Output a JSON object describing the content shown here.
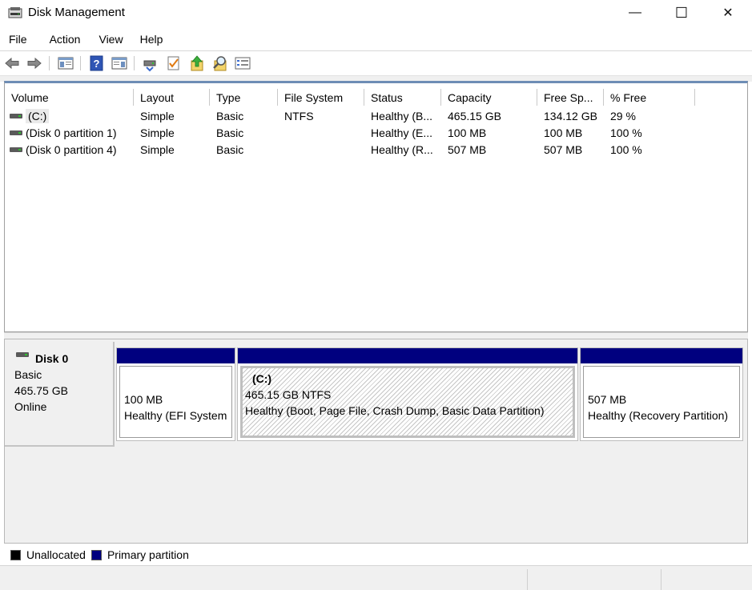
{
  "window": {
    "title": "Disk Management",
    "minimize_glyph": "—",
    "maximize_glyph": "☐",
    "close_glyph": "✕"
  },
  "menu": [
    "File",
    "Action",
    "View",
    "Help"
  ],
  "toolbar": {
    "icons": [
      "back-arrow-icon",
      "forward-arrow-icon",
      "show-hide-console-tree-icon",
      "help-icon",
      "show-hide-action-pane-icon",
      "connect-drive-icon",
      "check-icon",
      "up-arrow-icon",
      "search-icon",
      "properties-list-icon"
    ]
  },
  "volume_list": {
    "columns": [
      "Volume",
      "Layout",
      "Type",
      "File System",
      "Status",
      "Capacity",
      "Free Sp...",
      "% Free"
    ],
    "rows": [
      {
        "volume": "(C:)",
        "layout": "Simple",
        "type": "Basic",
        "file_system": "NTFS",
        "status": "Healthy (B...",
        "capacity": "465.15 GB",
        "free_space": "134.12 GB",
        "percent_free": "29 %"
      },
      {
        "volume": "(Disk 0 partition 1)",
        "layout": "Simple",
        "type": "Basic",
        "file_system": "",
        "status": "Healthy (E...",
        "capacity": "100 MB",
        "free_space": "100 MB",
        "percent_free": "100 %"
      },
      {
        "volume": "(Disk 0 partition 4)",
        "layout": "Simple",
        "type": "Basic",
        "file_system": "",
        "status": "Healthy (R...",
        "capacity": "507 MB",
        "free_space": "507 MB",
        "percent_free": "100 %"
      }
    ]
  },
  "disk": {
    "name": "Disk 0",
    "type": "Basic",
    "size": "465.75 GB",
    "state": "Online",
    "partitions": [
      {
        "title": "",
        "size_line": "100 MB",
        "status_line": "Healthy (EFI System"
      },
      {
        "title": "(C:)",
        "size_line": "465.15 GB NTFS",
        "status_line": "Healthy (Boot, Page File, Crash Dump, Basic Data Partition)"
      },
      {
        "title": "",
        "size_line": "507 MB",
        "status_line": "Healthy (Recovery Partition)"
      }
    ]
  },
  "legend": [
    {
      "label": "Unallocated",
      "color": "#000000"
    },
    {
      "label": "Primary partition",
      "color": "#00007f"
    }
  ],
  "colors": {
    "primary_partition": "#00007f",
    "unallocated": "#000000",
    "list_header_accent": "#6e8db5"
  }
}
